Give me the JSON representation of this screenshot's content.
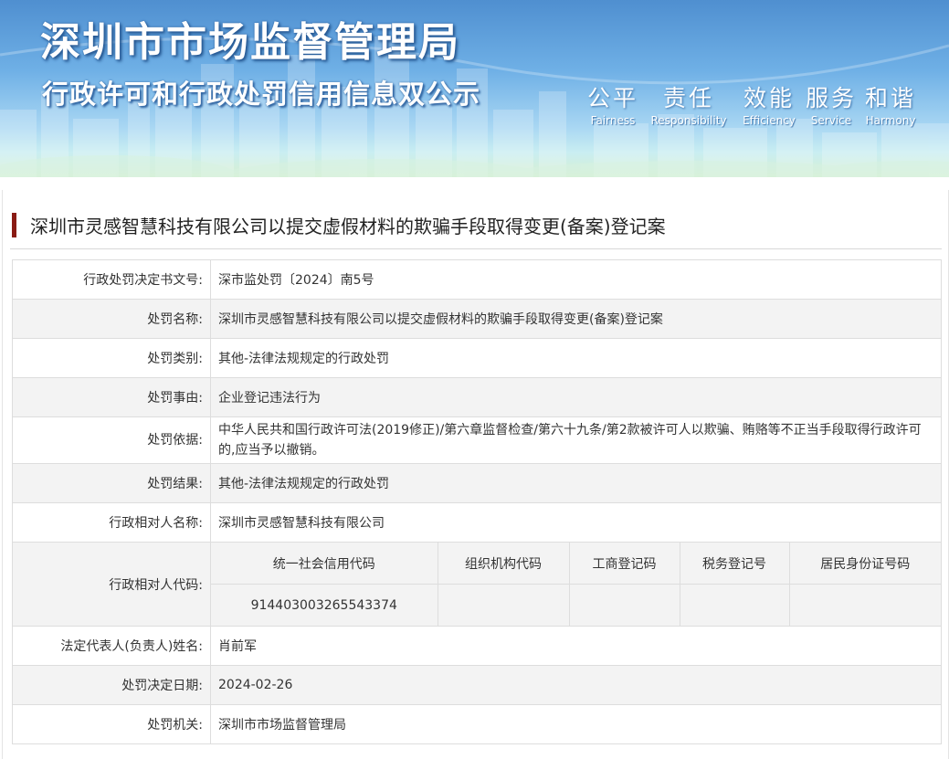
{
  "banner": {
    "title": "深圳市市场监督管理局",
    "subtitle": "行政许可和行政处罚信用信息双公示",
    "slogans": [
      {
        "cn": "公平",
        "en": "Fairness"
      },
      {
        "cn": "责任",
        "en": "Responsibility"
      },
      {
        "cn": "效能",
        "en": "Efficiency"
      },
      {
        "cn": "服务",
        "en": "Service"
      },
      {
        "cn": "和谐",
        "en": "Harmony"
      }
    ]
  },
  "page_title": "深圳市灵感智慧科技有限公司以提交虚假材料的欺骗手段取得变更(备案)登记案",
  "rows": [
    {
      "label": "行政处罚决定书文号:",
      "value": "深市监处罚〔2024〕南5号"
    },
    {
      "label": "处罚名称:",
      "value": "深圳市灵感智慧科技有限公司以提交虚假材料的欺骗手段取得变更(备案)登记案"
    },
    {
      "label": "处罚类别:",
      "value": "其他-法律法规规定的行政处罚"
    },
    {
      "label": "处罚事由:",
      "value": "企业登记违法行为"
    },
    {
      "label": "处罚依据:",
      "value": "中华人民共和国行政许可法(2019修正)/第六章监督检查/第六十九条/第2款被许可人以欺骗、贿赂等不正当手段取得行政许可的,应当予以撤销。"
    },
    {
      "label": "处罚结果:",
      "value": "其他-法律法规规定的行政处罚"
    },
    {
      "label": "行政相对人名称:",
      "value": "深圳市灵感智慧科技有限公司"
    }
  ],
  "codes": {
    "label": "行政相对人代码:",
    "headers": [
      "统一社会信用代码",
      "组织机构代码",
      "工商登记码",
      "税务登记号",
      "居民身份证号码"
    ],
    "values": [
      "914403003265543374",
      "",
      "",
      "",
      ""
    ]
  },
  "rows_after": [
    {
      "label": "法定代表人(负责人)姓名:",
      "value": "肖前军"
    },
    {
      "label": "处罚决定日期:",
      "value": "2024-02-26"
    },
    {
      "label": "处罚机关:",
      "value": "深圳市市场监督管理局"
    }
  ]
}
